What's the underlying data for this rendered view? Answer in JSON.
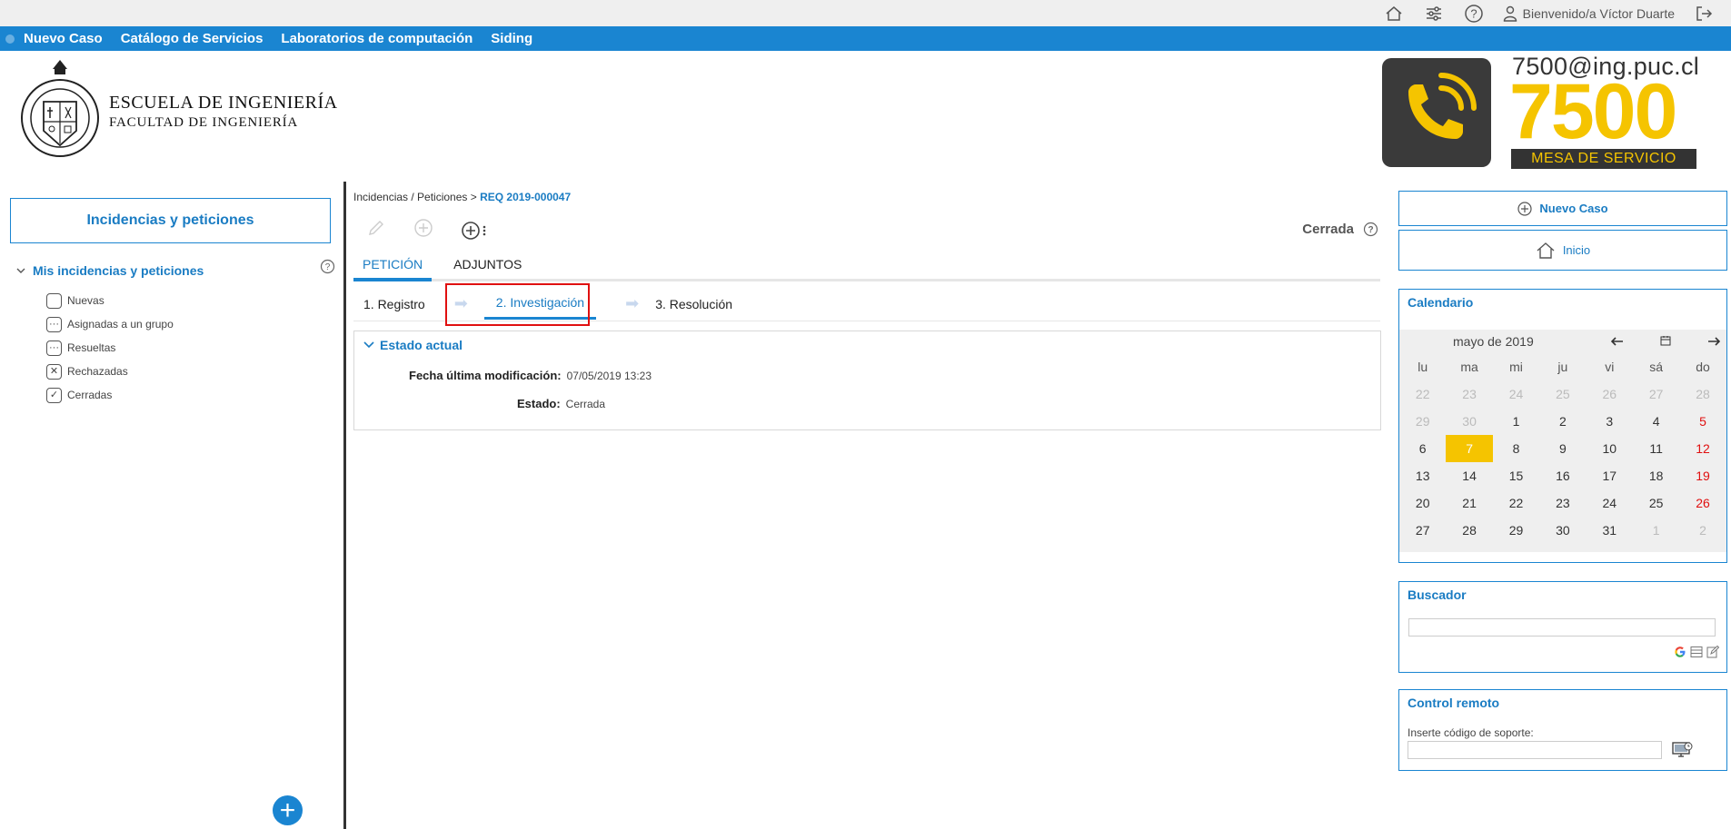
{
  "topbar": {
    "welcome": "Bienvenido/a Víctor Duarte"
  },
  "nav": {
    "items": [
      "Nuevo Caso",
      "Catálogo de Servicios",
      "Laboratorios de computación",
      "Siding"
    ]
  },
  "logo": {
    "line1": "ESCUELA DE INGENIERÍA",
    "line2": "FACULTAD DE INGENIERÍA"
  },
  "brand": {
    "email": "7500@ing.puc.cl",
    "number": "7500",
    "tagline": "MESA DE SERVICIO",
    "accent": "#f5c400"
  },
  "left": {
    "title": "Incidencias y peticiones",
    "tree_head": "Mis incidencias y peticiones",
    "items": [
      {
        "label": "Nuevas",
        "icon": "empty-box-icon"
      },
      {
        "label": "Asignadas a un grupo",
        "icon": "dots-box-icon"
      },
      {
        "label": "Resueltas",
        "icon": "dots-box-icon"
      },
      {
        "label": "Rechazadas",
        "icon": "x-box-icon"
      },
      {
        "label": "Cerradas",
        "icon": "check-box-icon"
      }
    ]
  },
  "center": {
    "breadcrumb_prefix": "Incidencias / Peticiones > ",
    "breadcrumb_req": "REQ 2019-000047",
    "status": "Cerrada",
    "tabs": [
      "PETICIÓN",
      "ADJUNTOS"
    ],
    "steps": [
      "1. Registro",
      "2. Investigación",
      "3. Resolución"
    ],
    "panel_title": "Estado actual",
    "fields": [
      {
        "label": "Fecha última modificación:",
        "value": "07/05/2019 13:23"
      },
      {
        "label": "Estado:",
        "value": "Cerrada"
      }
    ]
  },
  "right": {
    "new_case": "Nuevo Caso",
    "home": "Inicio",
    "calendar_title": "Calendario",
    "calendar_month": "mayo de 2019",
    "weekdays": [
      "lu",
      "ma",
      "mi",
      "ju",
      "vi",
      "sá",
      "do"
    ],
    "weeks": [
      [
        "22",
        "23",
        "24",
        "25",
        "26",
        "27",
        "28"
      ],
      [
        "29",
        "30",
        "1",
        "2",
        "3",
        "4",
        "5"
      ],
      [
        "6",
        "7",
        "8",
        "9",
        "10",
        "11",
        "12"
      ],
      [
        "13",
        "14",
        "15",
        "16",
        "17",
        "18",
        "19"
      ],
      [
        "20",
        "21",
        "22",
        "23",
        "24",
        "25",
        "26"
      ],
      [
        "27",
        "28",
        "29",
        "30",
        "31",
        "1",
        "2"
      ]
    ],
    "today": "7",
    "search_title": "Buscador",
    "remote_title": "Control remoto",
    "remote_label": "Inserte código de soporte:"
  }
}
